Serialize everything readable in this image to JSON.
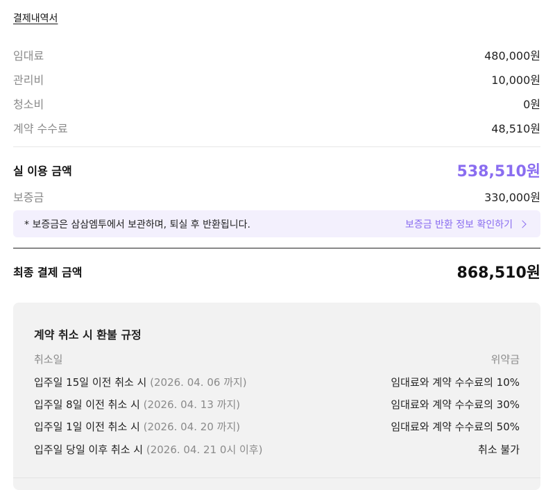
{
  "header": {
    "title": "결제내역서"
  },
  "charges": [
    {
      "label": "임대료",
      "value": "480,000원"
    },
    {
      "label": "관리비",
      "value": "10,000원"
    },
    {
      "label": "청소비",
      "value": "0원"
    },
    {
      "label": "계약 수수료",
      "value": "48,510원"
    }
  ],
  "actual": {
    "label": "실 이용 금액",
    "value": "538,510원"
  },
  "deposit": {
    "label": "보증금",
    "value": "330,000원"
  },
  "notice": {
    "text": "* 보증금은 삼삼엠투에서 보관하며, 퇴실 후 반환됩니다.",
    "link": "보증금 반환 정보 확인하기"
  },
  "final": {
    "label": "최종 결제 금액",
    "value": "868,510원"
  },
  "policy": {
    "title": "계약 취소 시 환불 규정",
    "header_left": "취소일",
    "header_right": "위약금",
    "rows": [
      {
        "when": "입주일 15일 이전 취소 시",
        "date": "(2026. 04. 06 까지)",
        "penalty": "임대료와 계약 수수료의 10%"
      },
      {
        "when": "입주일 8일 이전 취소 시",
        "date": "(2026. 04. 13 까지)",
        "penalty": "임대료와 계약 수수료의 30%"
      },
      {
        "when": "입주일 1일 이전 취소 시",
        "date": "(2026. 04. 20 까지)",
        "penalty": "임대료와 계약 수수료의 50%"
      },
      {
        "when": "입주일 당일 이후 취소 시",
        "date": "(2026. 04. 21 0시 이후)",
        "penalty": "취소 불가"
      }
    ]
  },
  "colors": {
    "accent": "#8a6df0",
    "notice_bg": "#f3f0fd",
    "policy_bg": "#f2f2f2"
  }
}
